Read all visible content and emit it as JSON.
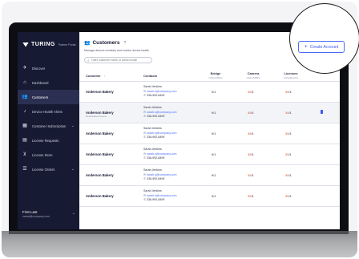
{
  "brand": {
    "name": "TURING",
    "sub": "Partner Portal"
  },
  "sidebar": {
    "items": [
      {
        "label": "Discover",
        "icon": "rocket-icon",
        "glyph": "✈",
        "active": false,
        "chevron": false
      },
      {
        "label": "Dashboard",
        "icon": "home-icon",
        "glyph": "⌂",
        "active": false,
        "chevron": false
      },
      {
        "label": "Customers",
        "icon": "users-icon",
        "glyph": "👥",
        "active": true,
        "chevron": false
      },
      {
        "label": "Device Health Alerts",
        "icon": "bell-icon",
        "glyph": "♪",
        "active": false,
        "chevron": false
      },
      {
        "label": "Customer Subscription",
        "icon": "calendar-icon",
        "glyph": "▦",
        "active": false,
        "chevron": true
      },
      {
        "label": "License Requests",
        "icon": "document-icon",
        "glyph": "▤",
        "active": false,
        "chevron": false
      },
      {
        "label": "License Store",
        "icon": "cart-icon",
        "glyph": "⊻",
        "active": false,
        "chevron": false
      },
      {
        "label": "License Orders",
        "icon": "list-icon",
        "glyph": "☰",
        "active": false,
        "chevron": true
      }
    ],
    "user": {
      "name": "First Last",
      "email": "name@company.com"
    }
  },
  "page": {
    "title": "Customers",
    "help": "?",
    "subtitle": "Manage devices remotely and monitor device health",
    "search_placeholder": "Enter customer name or admin email",
    "create_label": "Create Account"
  },
  "table": {
    "headers": {
      "customer": "Customer",
      "sort": "↓",
      "contacts": "Contacts",
      "bridge": "Bridge",
      "camera": "Camera",
      "licenses": "Licenses",
      "status_sub": "Online/Offline",
      "licenses_sub": "Active/Expired"
    },
    "rows": [
      {
        "name": "Anderson Bakery",
        "sub": "",
        "contact": "Sarah Jenkins",
        "email": "sarah.s@company.com",
        "phone": "336-992-8499",
        "bridge_on": "9",
        "bridge_off": "1",
        "camera_on": "39",
        "camera_off": "1",
        "lic_on": "39",
        "lic_off": "1",
        "trash": false
      },
      {
        "name": "Anderson Bakery",
        "sub": "Deactivated Access",
        "contact": "Sarah Jenkins",
        "email": "sarah.s@company.com",
        "phone": "336-992-8499",
        "bridge_on": "9",
        "bridge_off": "1",
        "camera_on": "39",
        "camera_off": "1",
        "lic_on": "39",
        "lic_off": "1",
        "trash": true
      },
      {
        "name": "Anderson Bakery",
        "sub": "",
        "contact": "Sarah Jenkins",
        "email": "sarah.s@company.com",
        "phone": "336-992-8499",
        "bridge_on": "9",
        "bridge_off": "1",
        "camera_on": "39",
        "camera_off": "1",
        "lic_on": "39",
        "lic_off": "1",
        "trash": false
      },
      {
        "name": "Anderson Bakery",
        "sub": "",
        "contact": "Sarah Jenkins",
        "email": "sarah.s@company.com",
        "phone": "336-992-8499",
        "bridge_on": "9",
        "bridge_off": "1",
        "camera_on": "39",
        "camera_off": "1",
        "lic_on": "39",
        "lic_off": "1",
        "trash": false
      },
      {
        "name": "Anderson Bakery",
        "sub": "",
        "contact": "Sarah Jenkins",
        "email": "sarah.s@company.com",
        "phone": "336-992-8499",
        "bridge_on": "9",
        "bridge_off": "1",
        "camera_on": "39",
        "camera_off": "1",
        "lic_on": "39",
        "lic_off": "1",
        "trash": false
      },
      {
        "name": "Anderson Bakery",
        "sub": "",
        "contact": "Sarah Jenkins",
        "email": "sarah.s@company.com",
        "phone": "336-992-8499",
        "bridge_on": "9",
        "bridge_off": "1",
        "camera_on": "39",
        "camera_off": "1",
        "lic_on": "39",
        "lic_off": "1",
        "trash": false
      }
    ]
  },
  "colors": {
    "sidebar": "#161a33",
    "accent": "#4a6cf7",
    "danger": "#e0442c"
  }
}
